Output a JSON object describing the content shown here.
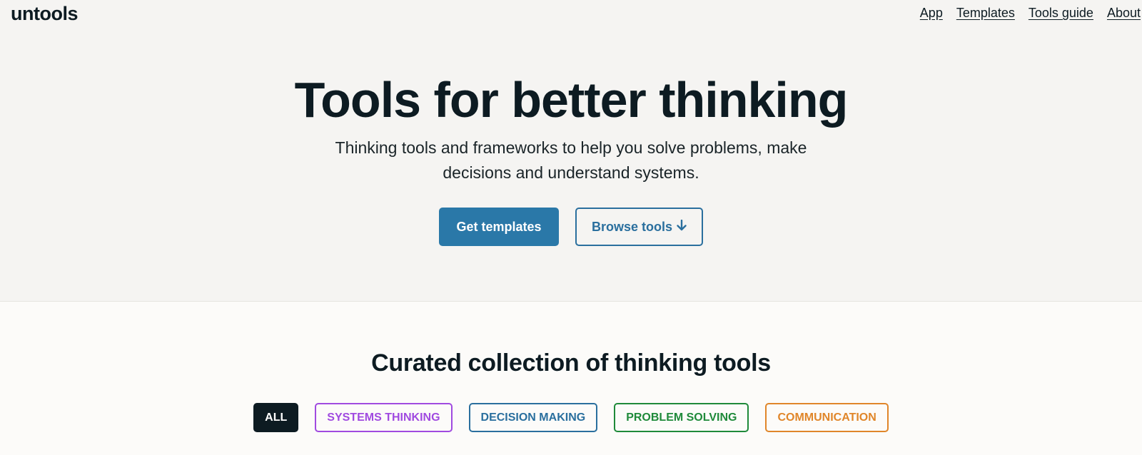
{
  "header": {
    "logo": "untools",
    "nav": [
      "App",
      "Templates",
      "Tools guide",
      "About"
    ]
  },
  "hero": {
    "title": "Tools for better thinking",
    "subtitle": "Thinking tools and frameworks to help you solve problems, make decisions and understand systems.",
    "primary_button": "Get templates",
    "secondary_button": "Browse tools",
    "secondary_button_icon": "arrow-down-icon"
  },
  "collection": {
    "title": "Curated collection of thinking tools",
    "filters": [
      "ALL",
      "SYSTEMS THINKING",
      "DECISION MAKING",
      "PROBLEM SOLVING",
      "COMMUNICATION"
    ]
  },
  "colors": {
    "hero_background": "#f5f4f2",
    "page_background": "#fcfbf9",
    "primary": "#2a78a8",
    "text": "#0d1b22",
    "systems_thinking": "#a04ae0",
    "decision_making": "#2a6f9e",
    "problem_solving": "#1f8a3a",
    "communication": "#e0862a"
  }
}
